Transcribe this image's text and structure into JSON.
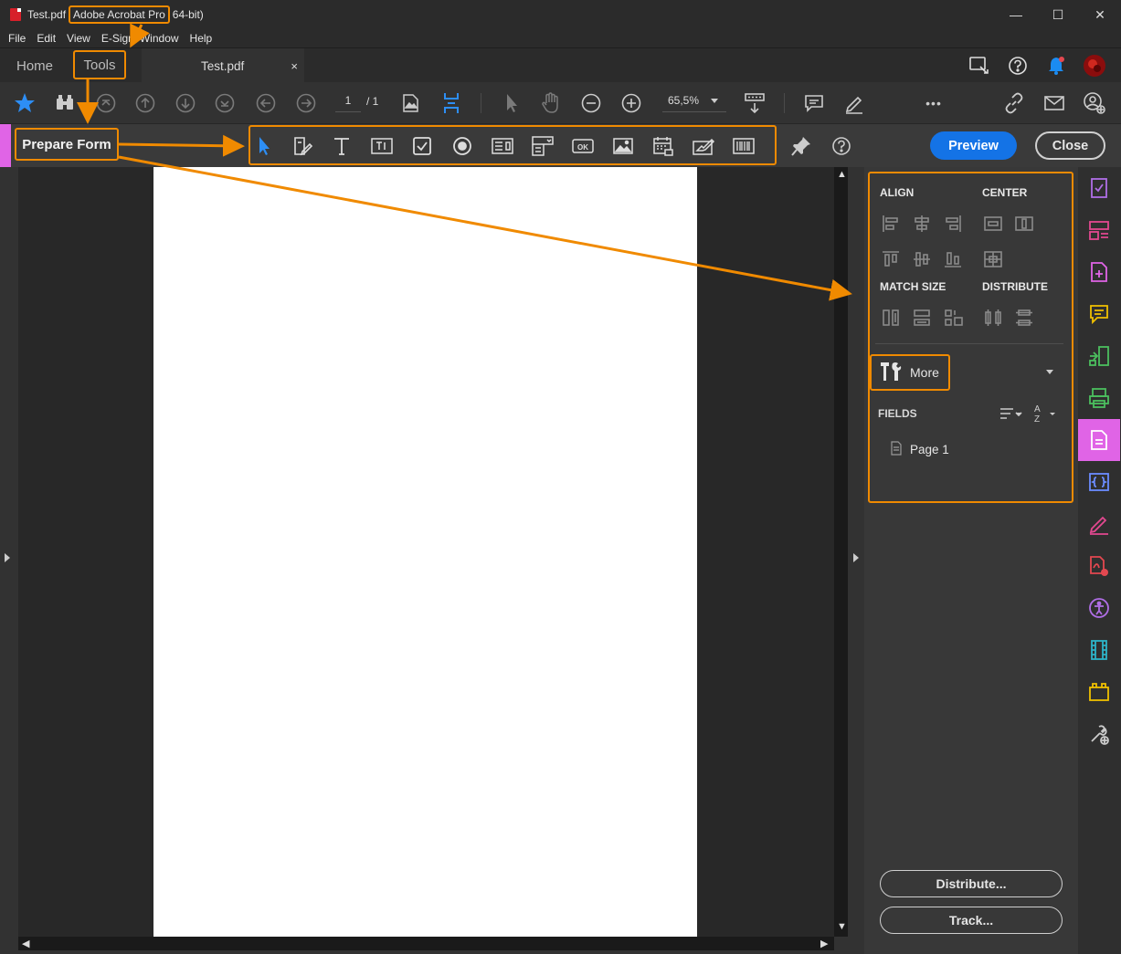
{
  "window": {
    "file_name": "Test.pdf",
    "app_name": "Adobe Acrobat Pro",
    "arch": "64-bit)",
    "minimize": "—",
    "maximize": "☐",
    "close": "✕"
  },
  "menu": [
    "File",
    "Edit",
    "View",
    "E-Sign",
    "Window",
    "Help"
  ],
  "tabs": {
    "home": "Home",
    "tools": "Tools",
    "document": "Test.pdf",
    "close": "×"
  },
  "toolbar": {
    "page_current": "1",
    "page_total": "/ 1",
    "zoom": "65,5%",
    "more": "•••"
  },
  "form_bar": {
    "title": "Prepare Form",
    "preview": "Preview",
    "close": "Close"
  },
  "right_panel": {
    "align_label": "ALIGN",
    "center_label": "CENTER",
    "match_size_label": "MATCH SIZE",
    "distribute_label": "DISTRIBUTE",
    "more_label": "More",
    "fields_label": "FIELDS",
    "page_node": "Page 1",
    "distribute_button": "Distribute...",
    "track_button": "Track..."
  },
  "colors": {
    "annotation": "#f08a00",
    "accent_blue": "#1473e6",
    "form_accent": "#e064e6"
  }
}
